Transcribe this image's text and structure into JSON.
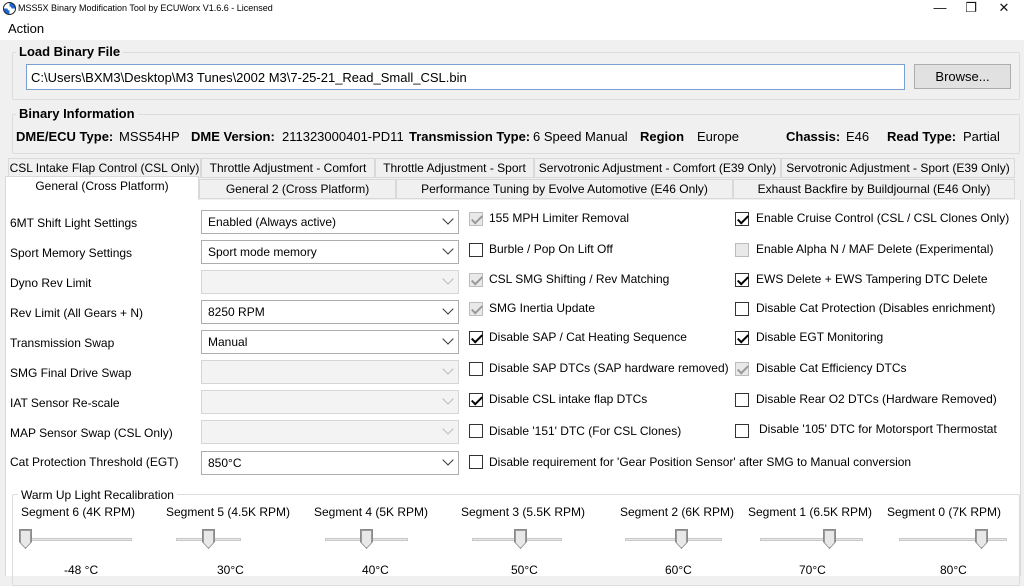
{
  "window": {
    "title": "MSS5X Binary Modification Tool by ECUWorx V1.6.6 - Licensed"
  },
  "menu": {
    "action": "Action"
  },
  "load": {
    "label": "Load Binary File",
    "path": "C:\\Users\\BXM3\\Desktop\\M3 Tunes\\2002 M3\\7-25-21_Read_Small_CSL.bin",
    "browse": "Browse..."
  },
  "info": {
    "label": "Binary Information",
    "dme_key": "DME/ECU Type:",
    "dme_val": "MSS54HP",
    "ver_key": "DME Version:",
    "ver_val": "211323000401-PD11",
    "trans_key": "Transmission Type:",
    "trans_val": "6 Speed Manual",
    "region_key": "Region",
    "region_val": "Europe",
    "chassis_key": "Chassis:",
    "chassis_val": "E46",
    "read_key": "Read Type:",
    "read_val": "Partial"
  },
  "tabs_row1": [
    "CSL Intake Flap Control (CSL Only)",
    "Throttle Adjustment - Comfort",
    "Throttle Adjustment - Sport",
    "Servotronic Adjustment - Comfort (E39 Only)",
    "Servotronic Adjustment - Sport (E39 Only)"
  ],
  "tabs_row2": [
    "General (Cross Platform)",
    "General 2 (Cross Platform)",
    "Performance Tuning by Evolve Automotive (E46 Only)",
    "Exhaust Backfire by Buildjournal (E46 Only)"
  ],
  "settings": [
    {
      "label": "6MT Shift Light Settings",
      "value": "Enabled (Always active)",
      "enabled": true
    },
    {
      "label": "Sport Memory Settings",
      "value": "Sport mode memory",
      "enabled": true
    },
    {
      "label": "Dyno Rev Limit",
      "value": "",
      "enabled": false
    },
    {
      "label": "Rev Limit (All Gears + N)",
      "value": "8250 RPM",
      "enabled": true
    },
    {
      "label": "Transmission Swap",
      "value": "Manual",
      "enabled": true
    },
    {
      "label": "SMG Final Drive Swap",
      "value": "",
      "enabled": false
    },
    {
      "label": "IAT Sensor Re-scale",
      "value": "",
      "enabled": false
    },
    {
      "label": "MAP Sensor Swap (CSL Only)",
      "value": "",
      "enabled": false
    },
    {
      "label": "Cat Protection Threshold (EGT)",
      "value": "850°C",
      "enabled": true
    }
  ],
  "checks_col1": [
    {
      "label": "155 MPH Limiter Removal",
      "checked": true,
      "enabled": false
    },
    {
      "label": "Burble / Pop On Lift Off",
      "checked": false,
      "enabled": true
    },
    {
      "label": "CSL SMG Shifting / Rev Matching",
      "checked": true,
      "enabled": false
    },
    {
      "label": "SMG Inertia Update",
      "checked": true,
      "enabled": false
    },
    {
      "label": "Disable SAP / Cat Heating Sequence",
      "checked": true,
      "enabled": true
    },
    {
      "label": "Disable SAP DTCs (SAP hardware removed)",
      "checked": false,
      "enabled": true
    },
    {
      "label": "Disable CSL intake flap DTCs",
      "checked": true,
      "enabled": true
    },
    {
      "label": "Disable '151' DTC (For CSL Clones)",
      "checked": false,
      "enabled": true
    },
    {
      "label": "Disable requirement for 'Gear Position Sensor' after SMG to Manual conversion",
      "checked": false,
      "enabled": true
    }
  ],
  "checks_col2": [
    {
      "label": "Enable Cruise Control (CSL / CSL Clones Only)",
      "checked": true,
      "enabled": true
    },
    {
      "label": "Enable Alpha N / MAF Delete (Experimental)",
      "checked": false,
      "enabled": false
    },
    {
      "label": "EWS Delete + EWS Tampering DTC Delete",
      "checked": true,
      "enabled": true
    },
    {
      "label": "Disable Cat Protection (Disables enrichment)",
      "checked": false,
      "enabled": true
    },
    {
      "label": "Disable EGT Monitoring",
      "checked": true,
      "enabled": true
    },
    {
      "label": "Disable Cat Efficiency DTCs",
      "checked": true,
      "enabled": false
    },
    {
      "label": "Disable Rear O2 DTCs (Hardware Removed)",
      "checked": false,
      "enabled": true
    },
    {
      "label": "Disable '105' DTC for Motorsport Thermostat",
      "checked": false,
      "enabled": true
    }
  ],
  "warmup": {
    "label": "Warm Up Light Recalibration",
    "segments": [
      {
        "label": "Segment 6 (4K RPM)",
        "temp": "-48 °C",
        "level": 0.0
      },
      {
        "label": "Segment 5 (4.5K RPM)",
        "temp": "30°C",
        "level": 0.5
      },
      {
        "label": "Segment 4 (5K RPM)",
        "temp": "40°C",
        "level": 0.5
      },
      {
        "label": "Segment 3 (5.5K RPM)",
        "temp": "50°C",
        "level": 0.55
      },
      {
        "label": "Segment 2 (6K RPM)",
        "temp": "60°C",
        "level": 0.6
      },
      {
        "label": "Segment 1 (6.5K RPM)",
        "temp": "70°C",
        "level": 0.7
      },
      {
        "label": "Segment 0 (7K RPM)",
        "temp": "80°C",
        "level": 0.8
      }
    ]
  }
}
